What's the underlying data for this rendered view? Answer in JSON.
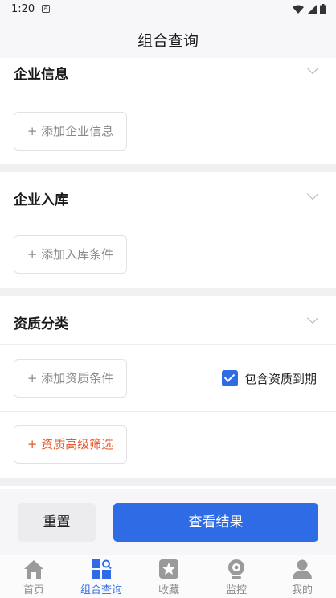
{
  "status_bar": {
    "time": "1:20",
    "badge": "A"
  },
  "nav": {
    "title": "组合查询"
  },
  "sections": [
    {
      "title": "企业信息",
      "add_label": "+ 添加企业信息"
    },
    {
      "title": "企业入库",
      "add_label": "+ 添加入库条件"
    },
    {
      "title": "资质分类",
      "add_label": "+ 添加资质条件",
      "checkbox_label": "包含资质到期",
      "checkbox_checked": true,
      "advanced_label": "+ 资质高级筛选"
    }
  ],
  "actions": {
    "reset_label": "重置",
    "result_label": "查看结果"
  },
  "tabs": [
    {
      "label": "首页",
      "icon": "home-icon"
    },
    {
      "label": "组合查询",
      "icon": "grid-search-icon",
      "active": true
    },
    {
      "label": "收藏",
      "icon": "star-icon"
    },
    {
      "label": "监控",
      "icon": "camera-icon"
    },
    {
      "label": "我的",
      "icon": "person-icon"
    }
  ],
  "colors": {
    "accent": "#2f6be5",
    "orange": "#e8562a",
    "tab_inactive": "#8c8c8c"
  }
}
